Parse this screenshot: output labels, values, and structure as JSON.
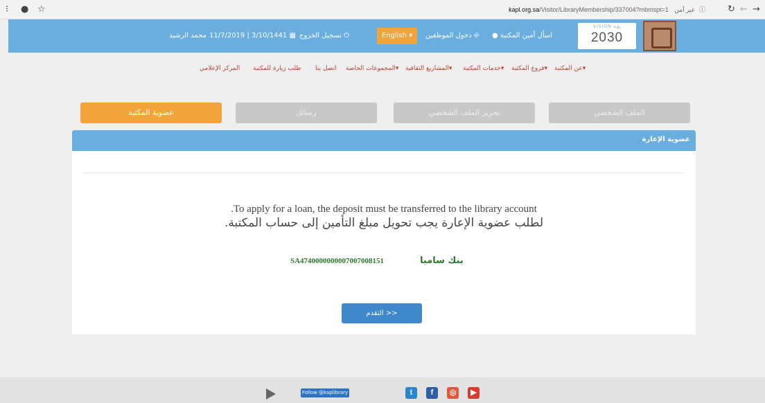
{
  "browser": {
    "url_host": "kapl.org.sa",
    "url_path": "/Visitor/LibraryMembership/337004?mbmspt=1",
    "insecure_label": "غير آمن",
    "info_icon": "info-icon",
    "reload_icon": "reload-icon",
    "back_icon": "back-arrow-icon",
    "forward_icon": "forward-arrow-icon",
    "account_icon": "account-icon",
    "star_icon": "star-icon"
  },
  "header": {
    "vision_small": "VISION رؤية",
    "vision_number": "2030",
    "ask_librarian": "اسأل أمين المكتبة",
    "login": "دخول الموظفين",
    "lang_button": "English",
    "logout": "تسجيل الخروج",
    "date": "11/7/2019 | 3/10/1441",
    "user_name": "محمد الرشيد"
  },
  "nav": {
    "items": [
      "عن المكتبة",
      "فروع المكتبة",
      "خدمات المكتبة",
      "المشاريع الثقافية",
      "المجموعات الخاصة",
      "اتصل بنا",
      "طلب زيارة للمكتبة",
      "المركز الإعلامي"
    ]
  },
  "tabs": [
    {
      "label": "الملف الشخصي"
    },
    {
      "label": "تحرير الملف الشخصي"
    },
    {
      "label": "رسائل"
    },
    {
      "label": "عضوية المكتبة"
    }
  ],
  "panel": {
    "title": "عضوية الإعارة",
    "message_en": ".To apply for a loan, the deposit must be transferred to the library account",
    "message_ar": "لطلب عضوية الإعارة يجب تحويل مبلغ التأمين إلى حساب المكتبة.",
    "bank_name": "بنك سامبا",
    "iban": "SA4740000000007007008151",
    "next_button": "التقدم >>"
  },
  "footer": {
    "follow_label": "Follow @kaplibrary",
    "icons": [
      "google-play-icon",
      "apple-icon",
      "twitter-icon",
      "facebook-icon",
      "instagram-icon",
      "youtube-icon"
    ]
  },
  "colors": {
    "header_blue": "#6aaee0",
    "accent_orange": "#f0a43a",
    "button_blue": "#3f88cc",
    "nav_red": "#b5452f",
    "bank_green": "#2a7a2a"
  }
}
